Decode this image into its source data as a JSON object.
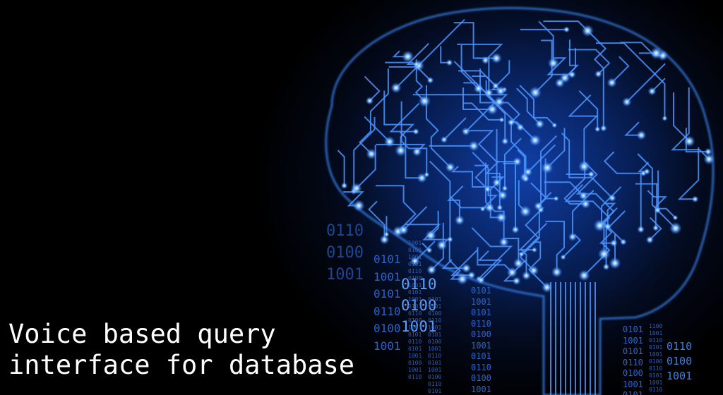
{
  "title": {
    "line1": "Voice based query",
    "line2": "interface for database"
  },
  "binary": {
    "large_left": [
      "0110",
      "0100",
      "1001"
    ],
    "mid_col_a": [
      "0101",
      "1001",
      "0101",
      "0110",
      "0100",
      "1001"
    ],
    "mid_col_b": [
      "0110",
      "0100",
      "1001"
    ],
    "small_col_1": [
      "1001",
      "0101",
      "1001",
      "0101",
      "0110",
      "0100",
      "1001",
      "0101",
      "1001",
      "0101",
      "0110",
      "0100",
      "1001",
      "0101",
      "0110",
      "0101",
      "1001",
      "0100",
      "1001",
      "0110"
    ],
    "small_col_2": [
      "0101",
      "1001",
      "0100",
      "0110",
      "1001",
      "0101",
      "0100",
      "1001",
      "0110",
      "0101",
      "1001",
      "0100",
      "0110",
      "0101"
    ],
    "mid_col_c": [
      "0101",
      "1001",
      "0101",
      "0110",
      "0100",
      "1001",
      "0101",
      "0110",
      "0100",
      "1001",
      "0110"
    ],
    "right_col_a": [
      "0101",
      "1001",
      "0101",
      "0110",
      "0100",
      "1001",
      "0101"
    ],
    "right_col_b": [
      "1100",
      "1001",
      "0110",
      "0101",
      "1001",
      "0100",
      "0110",
      "0101",
      "1001",
      "0110"
    ],
    "right_col_c": [
      "0110",
      "0100",
      "1001"
    ]
  },
  "colors": {
    "glow": "#1e6bff",
    "trace": "#3d8bff",
    "node": "#9fd0ff",
    "binary_dim": "#1c3f8a",
    "binary_bright": "#6aaeff"
  }
}
